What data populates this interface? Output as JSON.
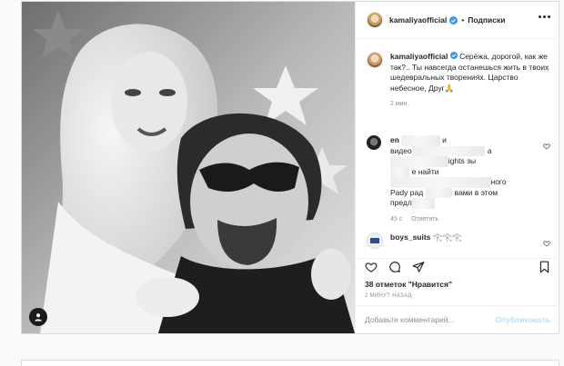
{
  "header": {
    "username": "kamaliyaofficial",
    "separator": "•",
    "follow_label": "Подписки"
  },
  "caption": {
    "username": "kamaliyaofficial",
    "text": "Серёжа, дорогой, как же так?.. Ты навсегда останешься жить в твоих шедевральных творениях. Царство небесное, Друг🙏",
    "time": "2 мин."
  },
  "comments": [
    {
      "username": "en",
      "text_lines": [
        "и",
        "видео",
        "а",
        "ights зы",
        "е найти",
        "ного",
        "Рady рад",
        "вами в этом",
        "предл"
      ],
      "time": "45 с",
      "reply_label": "Ответить"
    },
    {
      "username": "boys_suits",
      "text": "𓂀𓂀𓂀"
    }
  ],
  "likes": "38 отметок \"Нравится\"",
  "timestamp": "2 МИНУТ НАЗАД",
  "add_comment": {
    "placeholder": "Добавьте комментарий...",
    "publish_label": "Опубликовать"
  },
  "icons": {
    "like": "heart-icon",
    "comment": "comment-icon",
    "share": "share-icon",
    "save": "bookmark-icon",
    "tag": "user-tag-icon",
    "verified": "verified-badge-icon"
  },
  "colors": {
    "verified": "#3897f0",
    "publish_disabled": "#b2dffc",
    "muted": "#8e8e8e"
  }
}
